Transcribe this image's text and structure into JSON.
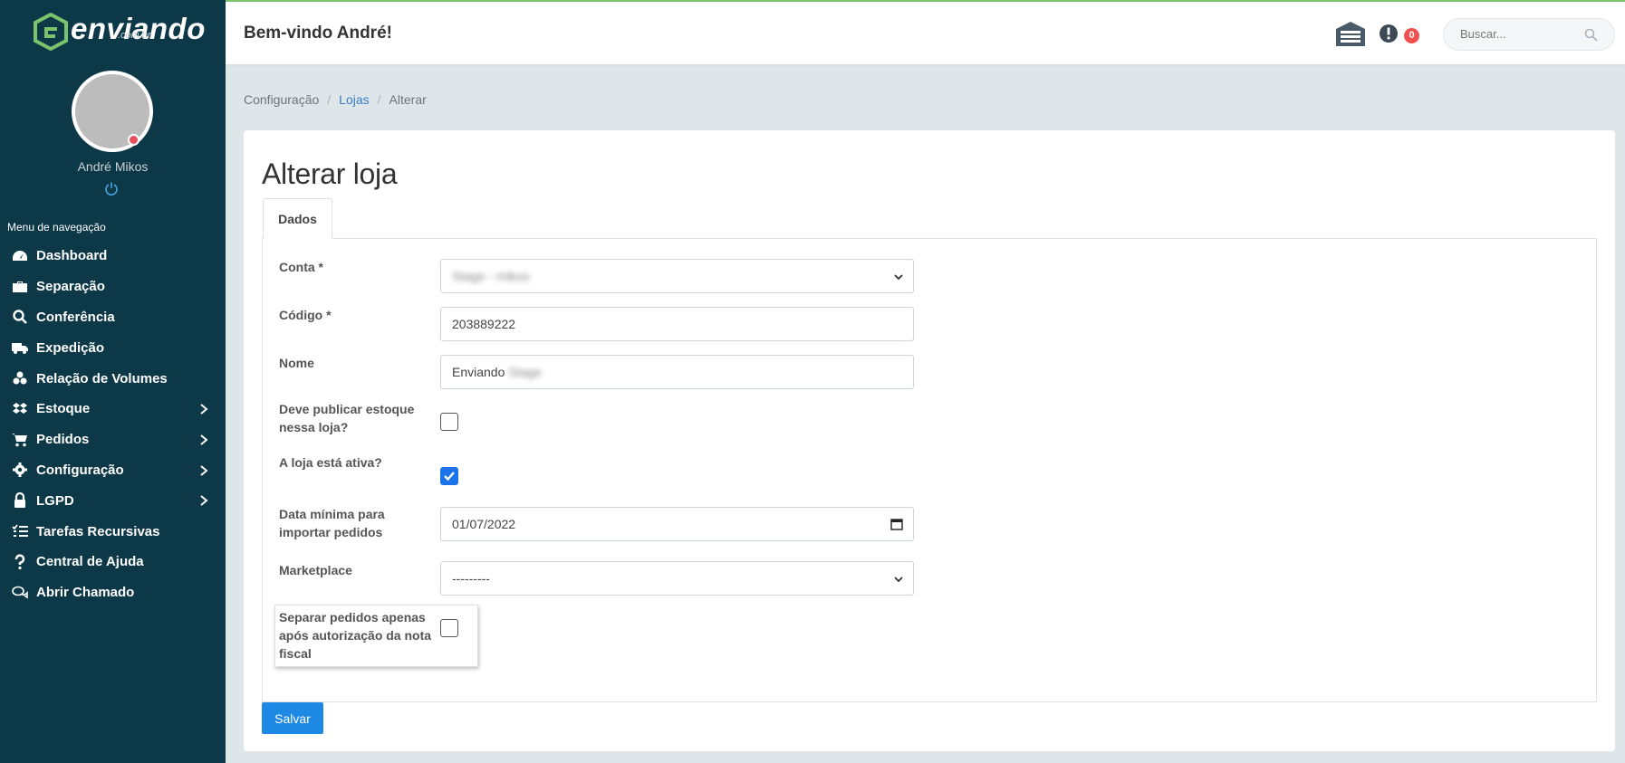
{
  "brand": {
    "name": "enviando",
    "domain": ".com.br"
  },
  "user": {
    "name": "André Mikos"
  },
  "nav": {
    "title": "Menu de navegação",
    "items": [
      {
        "label": "Dashboard",
        "icon": "dashboard-icon"
      },
      {
        "label": "Separação",
        "icon": "briefcase-icon"
      },
      {
        "label": "Conferência",
        "icon": "search-icon"
      },
      {
        "label": "Expedição",
        "icon": "truck-icon"
      },
      {
        "label": "Relação de Volumes",
        "icon": "boxes-icon"
      },
      {
        "label": "Estoque",
        "icon": "dropbox-icon"
      },
      {
        "label": "Pedidos",
        "icon": "cart-icon"
      },
      {
        "label": "Configuração",
        "icon": "gear-icon"
      },
      {
        "label": "LGPD",
        "icon": "lock-icon"
      },
      {
        "label": "Tarefas Recursivas",
        "icon": "tasks-icon"
      },
      {
        "label": "Central de Ajuda",
        "icon": "question-icon"
      },
      {
        "label": "Abrir Chamado",
        "icon": "chat-icon"
      }
    ]
  },
  "header": {
    "welcome": "Bem-vindo André!",
    "alert_count": "0",
    "search_placeholder": "Buscar..."
  },
  "breadcrumb": {
    "root": "Configuração",
    "parent": "Lojas",
    "current": "Alterar"
  },
  "page": {
    "title": "Alterar loja",
    "tab": "Dados"
  },
  "form": {
    "conta": {
      "label": "Conta *",
      "value": "Stage - mikos"
    },
    "codigo": {
      "label": "Código *",
      "value": "203889222"
    },
    "nome": {
      "label": "Nome",
      "value": "Enviando",
      "value_blurred": "Stage"
    },
    "publicar": {
      "label": "Deve publicar estoque nessa loja?",
      "checked": false
    },
    "ativa": {
      "label": "A loja está ativa?",
      "checked": true
    },
    "data_minima": {
      "label": "Data mínima para importar pedidos",
      "value": "01/07/2022"
    },
    "marketplace": {
      "label": "Marketplace",
      "value": "---------"
    },
    "separar": {
      "label": "Separar pedidos apenas após autorização da nota fiscal",
      "checked": false
    }
  },
  "actions": {
    "save": "Salvar"
  },
  "colors": {
    "sidebar": "#0c3848",
    "accent": "#1e88e5",
    "brand_green": "#7bc46b",
    "badge": "#f05050"
  }
}
